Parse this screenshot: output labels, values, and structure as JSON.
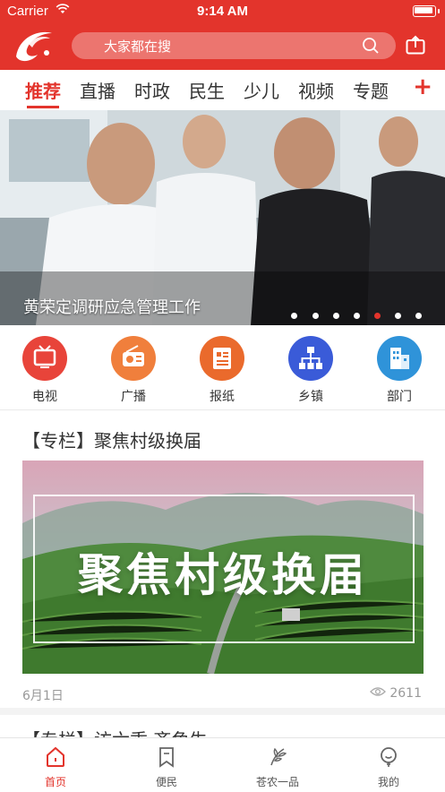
{
  "status": {
    "carrier": "Carrier",
    "time": "9:14 AM"
  },
  "header": {
    "search_placeholder": "大家都在搜",
    "brand_color": "#e3342c"
  },
  "tabs": [
    {
      "label": "推荐",
      "active": true
    },
    {
      "label": "直播"
    },
    {
      "label": "时政"
    },
    {
      "label": "民生"
    },
    {
      "label": "少儿"
    },
    {
      "label": "视频"
    },
    {
      "label": "专题"
    }
  ],
  "tabs_add": "+",
  "banner": {
    "caption": "黄荣定调研应急管理工作",
    "slide_count": 7,
    "active_slide": 6
  },
  "quick": [
    {
      "label": "电视",
      "icon": "tv-icon",
      "color": "#e8443a"
    },
    {
      "label": "广播",
      "icon": "radio-icon",
      "color": "#f07f3c"
    },
    {
      "label": "报纸",
      "icon": "newspaper-icon",
      "color": "#ea6a2c"
    },
    {
      "label": "乡镇",
      "icon": "org-chart-icon",
      "color": "#3a5bd8"
    },
    {
      "label": "部门",
      "icon": "building-icon",
      "color": "#2f93d9"
    }
  ],
  "article": {
    "title": "【专栏】聚焦村级换届",
    "image_text": "聚焦村级换届",
    "date": "6月1日",
    "views": "2611"
  },
  "article2": {
    "title": "【专栏】访六乖 齐角生"
  },
  "bottom": [
    {
      "label": "首页",
      "icon": "home-icon",
      "active": true
    },
    {
      "label": "便民",
      "icon": "bookmark-icon"
    },
    {
      "label": "苍农一品",
      "icon": "leaf-icon"
    },
    {
      "label": "我的",
      "icon": "profile-icon"
    }
  ]
}
